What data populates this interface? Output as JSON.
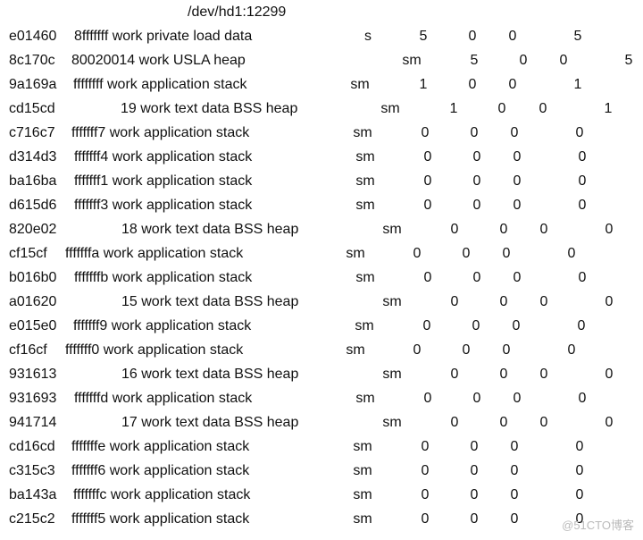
{
  "title": "/dev/hd1:12299",
  "watermark": "@51CTO博客",
  "rows": [
    {
      "seg": "e01460",
      "desc": "8fffffff work private load data",
      "type": "s",
      "c1": "5",
      "c2": "0",
      "c3": "0",
      "c4": "5"
    },
    {
      "seg": "8c170c",
      "desc": "80020014 work USLA heap",
      "type": "sm",
      "c1": "5",
      "c2": "0",
      "c3": "0",
      "c4": "5"
    },
    {
      "seg": "9a169a",
      "desc": "ffffffff work application stack",
      "type": "sm",
      "c1": "1",
      "c2": "0",
      "c3": "0",
      "c4": "1"
    },
    {
      "seg": "cd15cd",
      "desc": "19 work text data BSS heap",
      "type": "sm",
      "c1": "1",
      "c2": "0",
      "c3": "0",
      "c4": "1"
    },
    {
      "seg": "c716c7",
      "desc": "fffffff7 work application stack",
      "type": "sm",
      "c1": "0",
      "c2": "0",
      "c3": "0",
      "c4": "0"
    },
    {
      "seg": "d314d3",
      "desc": "fffffff4 work application stack",
      "type": "sm",
      "c1": "0",
      "c2": "0",
      "c3": "0",
      "c4": "0"
    },
    {
      "seg": "ba16ba",
      "desc": "fffffff1 work application stack",
      "type": "sm",
      "c1": "0",
      "c2": "0",
      "c3": "0",
      "c4": "0"
    },
    {
      "seg": "d615d6",
      "desc": "fffffff3 work application stack",
      "type": "sm",
      "c1": "0",
      "c2": "0",
      "c3": "0",
      "c4": "0"
    },
    {
      "seg": "820e02",
      "desc": "18 work text data BSS heap",
      "type": "sm",
      "c1": "0",
      "c2": "0",
      "c3": "0",
      "c4": "0"
    },
    {
      "seg": "cf15cf",
      "desc": "fffffffa work application stack",
      "type": "sm",
      "c1": "0",
      "c2": "0",
      "c3": "0",
      "c4": "0"
    },
    {
      "seg": "b016b0",
      "desc": "fffffffb work application stack",
      "type": "sm",
      "c1": "0",
      "c2": "0",
      "c3": "0",
      "c4": "0"
    },
    {
      "seg": "a01620",
      "desc": "15 work text data BSS heap",
      "type": "sm",
      "c1": "0",
      "c2": "0",
      "c3": "0",
      "c4": "0"
    },
    {
      "seg": "e015e0",
      "desc": "fffffff9 work application stack",
      "type": "sm",
      "c1": "0",
      "c2": "0",
      "c3": "0",
      "c4": "0"
    },
    {
      "seg": "cf16cf",
      "desc": "fffffff0 work application stack",
      "type": "sm",
      "c1": "0",
      "c2": "0",
      "c3": "0",
      "c4": "0"
    },
    {
      "seg": "931613",
      "desc": "16 work text data BSS heap",
      "type": "sm",
      "c1": "0",
      "c2": "0",
      "c3": "0",
      "c4": "0"
    },
    {
      "seg": "931693",
      "desc": "fffffffd work application stack",
      "type": "sm",
      "c1": "0",
      "c2": "0",
      "c3": "0",
      "c4": "0"
    },
    {
      "seg": "941714",
      "desc": "17 work text data BSS heap",
      "type": "sm",
      "c1": "0",
      "c2": "0",
      "c3": "0",
      "c4": "0"
    },
    {
      "seg": "cd16cd",
      "desc": "fffffffe work application stack",
      "type": "sm",
      "c1": "0",
      "c2": "0",
      "c3": "0",
      "c4": "0"
    },
    {
      "seg": "c315c3",
      "desc": "fffffff6 work application stack",
      "type": "sm",
      "c1": "0",
      "c2": "0",
      "c3": "0",
      "c4": "0"
    },
    {
      "seg": "ba143a",
      "desc": "fffffffc work application stack",
      "type": "sm",
      "c1": "0",
      "c2": "0",
      "c3": "0",
      "c4": "0"
    },
    {
      "seg": "c215c2",
      "desc": "fffffff5 work application stack",
      "type": "sm",
      "c1": "0",
      "c2": "0",
      "c3": "0",
      "c4": "0"
    }
  ]
}
